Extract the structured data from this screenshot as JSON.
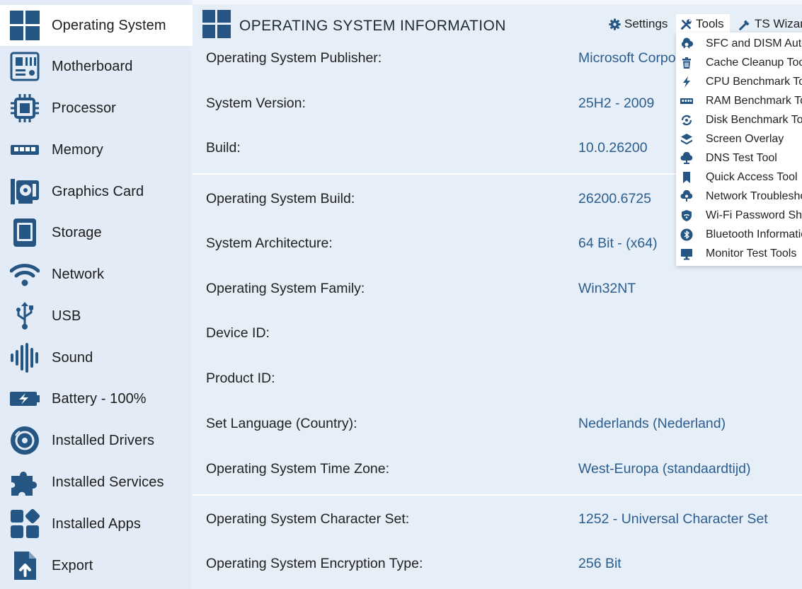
{
  "sidebar": {
    "items": [
      {
        "label": "Operating System",
        "icon": "windows-icon",
        "active": true
      },
      {
        "label": "Motherboard",
        "icon": "motherboard-icon"
      },
      {
        "label": "Processor",
        "icon": "processor-icon"
      },
      {
        "label": "Memory",
        "icon": "memory-icon"
      },
      {
        "label": "Graphics Card",
        "icon": "graphics-card-icon"
      },
      {
        "label": "Storage",
        "icon": "storage-icon"
      },
      {
        "label": "Network",
        "icon": "wifi-icon"
      },
      {
        "label": "USB",
        "icon": "usb-icon"
      },
      {
        "label": "Sound",
        "icon": "sound-wave-icon"
      },
      {
        "label": "Battery - 100%",
        "icon": "battery-icon"
      },
      {
        "label": "Installed Drivers",
        "icon": "disc-icon"
      },
      {
        "label": "Installed Services",
        "icon": "puzzle-icon"
      },
      {
        "label": "Installed Apps",
        "icon": "apps-grid-icon"
      },
      {
        "label": "Export",
        "icon": "export-file-icon"
      }
    ]
  },
  "header": {
    "title": "OPERATING SYSTEM INFORMATION"
  },
  "toolbar": {
    "settings_label": "Settings",
    "tools_label": "Tools",
    "wizard_label": "TS Wizard"
  },
  "tools_menu": {
    "items": [
      {
        "label": "SFC and DISM Auto",
        "icon": "gear-cloud-icon"
      },
      {
        "label": "Cache Cleanup Tool",
        "icon": "trash-icon"
      },
      {
        "label": "CPU Benchmark Tool",
        "icon": "bolt-icon"
      },
      {
        "label": "RAM Benchmark Tool",
        "icon": "ram-icon"
      },
      {
        "label": "Disk Benchmark Tool",
        "icon": "disk-refresh-icon"
      },
      {
        "label": "Screen Overlay",
        "icon": "layers-icon"
      },
      {
        "label": "DNS Test Tool",
        "icon": "cloud-dns-icon"
      },
      {
        "label": "Quick Access Tool",
        "icon": "bookmark-icon"
      },
      {
        "label": "Network Troubleshoot",
        "icon": "network-cloud-icon"
      },
      {
        "label": "Wi-Fi Password Show",
        "icon": "shield-wifi-icon"
      },
      {
        "label": "Bluetooth Information",
        "icon": "bluetooth-icon"
      },
      {
        "label": "Monitor Test Tools",
        "icon": "monitor-icon"
      }
    ]
  },
  "info_rows": [
    {
      "label": "Operating System Publisher:",
      "value": "Microsoft Corporation"
    },
    {
      "label": "System Version:",
      "value": "25H2 - 2009"
    },
    {
      "label": "Build:",
      "value": "10.0.26200"
    },
    {
      "label": "Operating System Build:",
      "value": "26200.6725"
    },
    {
      "label": "System Architecture:",
      "value": "64 Bit - (x64)"
    },
    {
      "label": "Operating System Family:",
      "value": "Win32NT"
    },
    {
      "label": "Device ID:",
      "value": ""
    },
    {
      "label": "Product ID:",
      "value": ""
    },
    {
      "label": "Set Language (Country):",
      "value": "Nederlands (Nederland)"
    },
    {
      "label": "Operating System Time Zone:",
      "value": "West-Europa (standaardtijd)"
    },
    {
      "label": "Operating System Character Set:",
      "value": "1252 - Universal Character Set"
    },
    {
      "label": "Operating System Encryption Type:",
      "value": "256 Bit"
    }
  ],
  "colors": {
    "accent": "#2c5d8f",
    "icon": "#245583",
    "background": "#e6eef8",
    "active_item": "#ffffff"
  }
}
